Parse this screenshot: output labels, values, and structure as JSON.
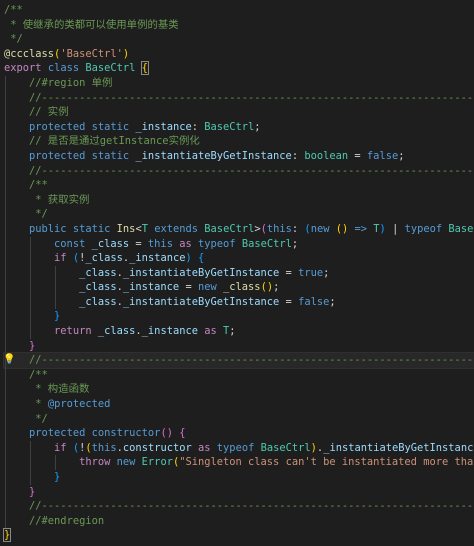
{
  "editor": {
    "lines": [
      {
        "tokens": [
          {
            "t": "/**",
            "c": "comment"
          }
        ]
      },
      {
        "tokens": [
          {
            "t": " * 使继承的类都可以使用单例的基类",
            "c": "comment"
          }
        ]
      },
      {
        "tokens": [
          {
            "t": " */",
            "c": "comment"
          }
        ]
      },
      {
        "tokens": [
          {
            "t": "@ccclass",
            "c": "func"
          },
          {
            "t": "(",
            "c": "bracket1"
          },
          {
            "t": "'BaseCtrl'",
            "c": "string"
          },
          {
            "t": ")",
            "c": "bracket1"
          }
        ]
      },
      {
        "tokens": [
          {
            "t": "export",
            "c": "control"
          },
          {
            "t": " ",
            "c": "plain"
          },
          {
            "t": "class",
            "c": "keyword"
          },
          {
            "t": " ",
            "c": "plain"
          },
          {
            "t": "BaseCtrl",
            "c": "type"
          },
          {
            "t": " ",
            "c": "plain"
          },
          {
            "t": "{",
            "c": "bracket1",
            "box": true
          }
        ]
      },
      {
        "tokens": [
          {
            "t": "    ",
            "c": "plain"
          },
          {
            "t": "//#region 单例",
            "c": "comment"
          }
        ]
      },
      {
        "tokens": [
          {
            "t": "    ",
            "c": "plain"
          },
          {
            "t": "//----------------------------------------------------------------------",
            "c": "comment"
          }
        ]
      },
      {
        "tokens": [
          {
            "t": "    ",
            "c": "plain"
          },
          {
            "t": "// 实例",
            "c": "comment"
          }
        ]
      },
      {
        "tokens": [
          {
            "t": "    ",
            "c": "plain"
          },
          {
            "t": "protected",
            "c": "keyword"
          },
          {
            "t": " ",
            "c": "plain"
          },
          {
            "t": "static",
            "c": "keyword"
          },
          {
            "t": " ",
            "c": "plain"
          },
          {
            "t": "_instance",
            "c": "var"
          },
          {
            "t": ": ",
            "c": "plain"
          },
          {
            "t": "BaseCtrl",
            "c": "type"
          },
          {
            "t": ";",
            "c": "plain"
          }
        ]
      },
      {
        "tokens": [
          {
            "t": "    ",
            "c": "plain"
          },
          {
            "t": "// 是否是通过getInstance实例化",
            "c": "comment"
          }
        ]
      },
      {
        "tokens": [
          {
            "t": "    ",
            "c": "plain"
          },
          {
            "t": "protected",
            "c": "keyword"
          },
          {
            "t": " ",
            "c": "plain"
          },
          {
            "t": "static",
            "c": "keyword"
          },
          {
            "t": " ",
            "c": "plain"
          },
          {
            "t": "_instantiateByGetInstance",
            "c": "var"
          },
          {
            "t": ": ",
            "c": "plain"
          },
          {
            "t": "boolean",
            "c": "type"
          },
          {
            "t": " = ",
            "c": "plain"
          },
          {
            "t": "false",
            "c": "keyword"
          },
          {
            "t": ";",
            "c": "plain"
          }
        ]
      },
      {
        "tokens": [
          {
            "t": "    ",
            "c": "plain"
          },
          {
            "t": "//----------------------------------------------------------------------",
            "c": "comment"
          }
        ]
      },
      {
        "tokens": [
          {
            "t": "    ",
            "c": "plain"
          },
          {
            "t": "/**",
            "c": "comment"
          }
        ]
      },
      {
        "tokens": [
          {
            "t": "    ",
            "c": "plain"
          },
          {
            "t": " * 获取实例",
            "c": "comment"
          }
        ]
      },
      {
        "tokens": [
          {
            "t": "    ",
            "c": "plain"
          },
          {
            "t": " */",
            "c": "comment"
          }
        ]
      },
      {
        "tokens": [
          {
            "t": "    ",
            "c": "plain"
          },
          {
            "t": "public",
            "c": "keyword"
          },
          {
            "t": " ",
            "c": "plain"
          },
          {
            "t": "static",
            "c": "keyword"
          },
          {
            "t": " ",
            "c": "plain"
          },
          {
            "t": "Ins",
            "c": "func"
          },
          {
            "t": "<",
            "c": "plain"
          },
          {
            "t": "T",
            "c": "type"
          },
          {
            "t": " ",
            "c": "plain"
          },
          {
            "t": "extends",
            "c": "keyword"
          },
          {
            "t": " ",
            "c": "plain"
          },
          {
            "t": "BaseCtrl",
            "c": "type"
          },
          {
            "t": ">",
            "c": "plain"
          },
          {
            "t": "(",
            "c": "bracket2"
          },
          {
            "t": "this",
            "c": "keyword"
          },
          {
            "t": ": ",
            "c": "plain"
          },
          {
            "t": "(",
            "c": "bracket3"
          },
          {
            "t": "new",
            "c": "keyword"
          },
          {
            "t": " ",
            "c": "plain"
          },
          {
            "t": "()",
            "c": "bracket1"
          },
          {
            "t": " => ",
            "c": "keyword"
          },
          {
            "t": "T",
            "c": "type"
          },
          {
            "t": ")",
            "c": "bracket3"
          },
          {
            "t": " | ",
            "c": "plain"
          },
          {
            "t": "typeof",
            "c": "keyword"
          },
          {
            "t": " ",
            "c": "plain"
          },
          {
            "t": "BaseCtrl",
            "c": "type"
          },
          {
            "t": ")",
            "c": "bracket2"
          },
          {
            "t": ": ",
            "c": "plain"
          },
          {
            "t": "T",
            "c": "type"
          },
          {
            "t": " ",
            "c": "plain"
          },
          {
            "t": "{",
            "c": "bracket2"
          }
        ]
      },
      {
        "tokens": [
          {
            "t": "        ",
            "c": "plain"
          },
          {
            "t": "const",
            "c": "keyword"
          },
          {
            "t": " ",
            "c": "plain"
          },
          {
            "t": "_class",
            "c": "var"
          },
          {
            "t": " = ",
            "c": "plain"
          },
          {
            "t": "this",
            "c": "keyword"
          },
          {
            "t": " ",
            "c": "plain"
          },
          {
            "t": "as",
            "c": "control"
          },
          {
            "t": " ",
            "c": "plain"
          },
          {
            "t": "typeof",
            "c": "keyword"
          },
          {
            "t": " ",
            "c": "plain"
          },
          {
            "t": "BaseCtrl",
            "c": "type"
          },
          {
            "t": ";",
            "c": "plain"
          }
        ]
      },
      {
        "tokens": [
          {
            "t": "        ",
            "c": "plain"
          },
          {
            "t": "if",
            "c": "control"
          },
          {
            "t": " ",
            "c": "plain"
          },
          {
            "t": "(",
            "c": "bracket3"
          },
          {
            "t": "!",
            "c": "plain"
          },
          {
            "t": "_class",
            "c": "var"
          },
          {
            "t": ".",
            "c": "plain"
          },
          {
            "t": "_instance",
            "c": "var"
          },
          {
            "t": ")",
            "c": "bracket3"
          },
          {
            "t": " ",
            "c": "plain"
          },
          {
            "t": "{",
            "c": "bracket3"
          }
        ]
      },
      {
        "tokens": [
          {
            "t": "            ",
            "c": "plain"
          },
          {
            "t": "_class",
            "c": "var"
          },
          {
            "t": ".",
            "c": "plain"
          },
          {
            "t": "_instantiateByGetInstance",
            "c": "var"
          },
          {
            "t": " = ",
            "c": "plain"
          },
          {
            "t": "true",
            "c": "keyword"
          },
          {
            "t": ";",
            "c": "plain"
          }
        ]
      },
      {
        "tokens": [
          {
            "t": "            ",
            "c": "plain"
          },
          {
            "t": "_class",
            "c": "var"
          },
          {
            "t": ".",
            "c": "plain"
          },
          {
            "t": "_instance",
            "c": "var"
          },
          {
            "t": " = ",
            "c": "plain"
          },
          {
            "t": "new",
            "c": "keyword"
          },
          {
            "t": " ",
            "c": "plain"
          },
          {
            "t": "_class",
            "c": "func"
          },
          {
            "t": "()",
            "c": "bracket1"
          },
          {
            "t": ";",
            "c": "plain"
          }
        ]
      },
      {
        "tokens": [
          {
            "t": "            ",
            "c": "plain"
          },
          {
            "t": "_class",
            "c": "var"
          },
          {
            "t": ".",
            "c": "plain"
          },
          {
            "t": "_instantiateByGetInstance",
            "c": "var"
          },
          {
            "t": " = ",
            "c": "plain"
          },
          {
            "t": "false",
            "c": "keyword"
          },
          {
            "t": ";",
            "c": "plain"
          }
        ]
      },
      {
        "tokens": [
          {
            "t": "        ",
            "c": "plain"
          },
          {
            "t": "}",
            "c": "bracket3"
          }
        ]
      },
      {
        "tokens": [
          {
            "t": "        ",
            "c": "plain"
          },
          {
            "t": "return",
            "c": "control"
          },
          {
            "t": " ",
            "c": "plain"
          },
          {
            "t": "_class",
            "c": "var"
          },
          {
            "t": ".",
            "c": "plain"
          },
          {
            "t": "_instance",
            "c": "var"
          },
          {
            "t": " ",
            "c": "plain"
          },
          {
            "t": "as",
            "c": "control"
          },
          {
            "t": " ",
            "c": "plain"
          },
          {
            "t": "T",
            "c": "type"
          },
          {
            "t": ";",
            "c": "plain"
          }
        ]
      },
      {
        "tokens": [
          {
            "t": "    ",
            "c": "plain"
          },
          {
            "t": "}",
            "c": "bracket2"
          }
        ]
      },
      {
        "current": true,
        "bulb": true,
        "tokens": [
          {
            "t": "    ",
            "c": "plain"
          },
          {
            "t": "//----------------------------------------------------------------------",
            "c": "comment"
          }
        ]
      },
      {
        "tokens": [
          {
            "t": "    ",
            "c": "plain"
          },
          {
            "t": "/**",
            "c": "comment"
          }
        ]
      },
      {
        "tokens": [
          {
            "t": "    ",
            "c": "plain"
          },
          {
            "t": " * 构造函数",
            "c": "comment"
          }
        ]
      },
      {
        "tokens": [
          {
            "t": "    ",
            "c": "plain"
          },
          {
            "t": " * ",
            "c": "comment"
          },
          {
            "t": "@protected",
            "c": "keyword"
          }
        ]
      },
      {
        "tokens": [
          {
            "t": "    ",
            "c": "plain"
          },
          {
            "t": " */",
            "c": "comment"
          }
        ]
      },
      {
        "tokens": [
          {
            "t": "    ",
            "c": "plain"
          },
          {
            "t": "protected",
            "c": "keyword"
          },
          {
            "t": " ",
            "c": "plain"
          },
          {
            "t": "constructor",
            "c": "keyword"
          },
          {
            "t": "()",
            "c": "bracket2"
          },
          {
            "t": " ",
            "c": "plain"
          },
          {
            "t": "{",
            "c": "bracket2"
          }
        ]
      },
      {
        "tokens": [
          {
            "t": "        ",
            "c": "plain"
          },
          {
            "t": "if",
            "c": "control"
          },
          {
            "t": " ",
            "c": "plain"
          },
          {
            "t": "(",
            "c": "bracket3"
          },
          {
            "t": "!",
            "c": "plain"
          },
          {
            "t": "(",
            "c": "bracket1"
          },
          {
            "t": "this",
            "c": "keyword"
          },
          {
            "t": ".",
            "c": "plain"
          },
          {
            "t": "constructor",
            "c": "var"
          },
          {
            "t": " ",
            "c": "plain"
          },
          {
            "t": "as",
            "c": "control"
          },
          {
            "t": " ",
            "c": "plain"
          },
          {
            "t": "typeof",
            "c": "keyword"
          },
          {
            "t": " ",
            "c": "plain"
          },
          {
            "t": "BaseCtrl",
            "c": "type"
          },
          {
            "t": ")",
            "c": "bracket1"
          },
          {
            "t": ".",
            "c": "plain"
          },
          {
            "t": "_instantiateByGetInstance",
            "c": "var"
          },
          {
            "t": ")",
            "c": "bracket3"
          },
          {
            "t": " ",
            "c": "plain"
          },
          {
            "t": "{",
            "c": "bracket3"
          }
        ]
      },
      {
        "tokens": [
          {
            "t": "            ",
            "c": "plain"
          },
          {
            "t": "throw",
            "c": "control"
          },
          {
            "t": " ",
            "c": "plain"
          },
          {
            "t": "new",
            "c": "keyword"
          },
          {
            "t": " ",
            "c": "plain"
          },
          {
            "t": "Error",
            "c": "type"
          },
          {
            "t": "(",
            "c": "bracket1"
          },
          {
            "t": "\"Singleton class can't be instantiated more than once.\"",
            "c": "string"
          },
          {
            "t": ")",
            "c": "bracket1"
          },
          {
            "t": ";",
            "c": "plain"
          }
        ]
      },
      {
        "tokens": [
          {
            "t": "        ",
            "c": "plain"
          },
          {
            "t": "}",
            "c": "bracket3"
          }
        ]
      },
      {
        "tokens": [
          {
            "t": "    ",
            "c": "plain"
          },
          {
            "t": "}",
            "c": "bracket2"
          }
        ]
      },
      {
        "tokens": [
          {
            "t": "    ",
            "c": "plain"
          },
          {
            "t": "//----------------------------------------------------------------------",
            "c": "comment"
          }
        ]
      },
      {
        "tokens": [
          {
            "t": "    ",
            "c": "plain"
          },
          {
            "t": "//#endregion",
            "c": "comment"
          }
        ]
      },
      {
        "tokens": [
          {
            "t": "}",
            "c": "bracket1",
            "box": true
          }
        ],
        "cursor_after": true
      }
    ]
  },
  "icons": {
    "gutter": "lightbulb-icon"
  },
  "colors": {
    "background": "#1e1e1e",
    "comment": "#6a9955",
    "keyword": "#569cd6",
    "control": "#c586c0",
    "type": "#4ec9b0",
    "string": "#ce9178",
    "function": "#dcdcaa",
    "variable": "#9cdcfe",
    "bracket_gold": "#ffd700",
    "bracket_orchid": "#da70d6",
    "bracket_blue": "#179fff"
  }
}
